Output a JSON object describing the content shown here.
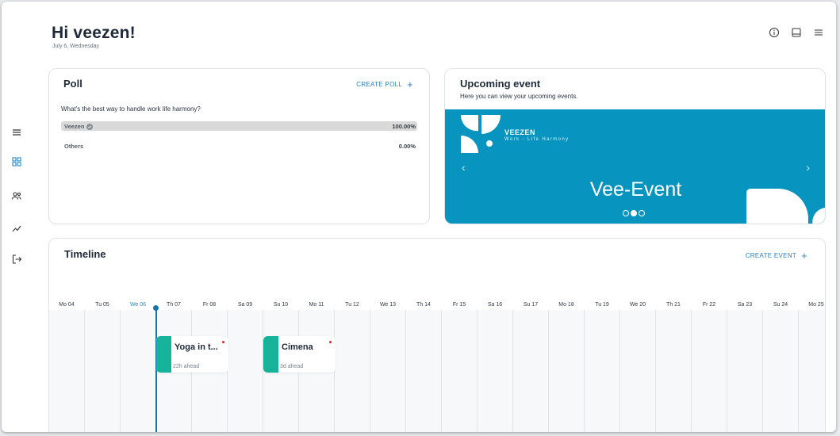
{
  "header": {
    "greeting": "Hi veezen!",
    "date": "July 6, Wednesday",
    "icons": [
      "info-icon",
      "inbox-icon",
      "menu-icon"
    ]
  },
  "sidebar": {
    "items": [
      {
        "icon": "menu-icon"
      },
      {
        "icon": "dashboard-icon",
        "active": true
      },
      {
        "icon": "users-icon"
      },
      {
        "icon": "trend-icon"
      },
      {
        "icon": "logout-icon"
      }
    ]
  },
  "colors": {
    "accent": "#2f7fc1",
    "banner": "#0794bf",
    "event": "#16b39a",
    "today": "#1775a9"
  },
  "poll": {
    "title": "Poll",
    "create_label": "CREATE POLL",
    "question": "What's the best way to handle work life harmony?",
    "options": [
      {
        "label": "Veezen",
        "percent": "100.00%",
        "fraction": 1.0,
        "voted": true
      },
      {
        "label": "Others",
        "percent": "0.00%",
        "fraction": 0.0,
        "voted": false
      }
    ]
  },
  "upcoming": {
    "title": "Upcoming event",
    "subtitle": "Here you can view your upcoming events.",
    "banner": {
      "brand": "VEEZEN",
      "tagline": "Work - Life Harmony",
      "title": "Vee-Event",
      "prev": "‹",
      "next": "›",
      "slides": 3,
      "active_slide": 2
    }
  },
  "timeline": {
    "title": "Timeline",
    "create_label": "CREATE EVENT",
    "days": [
      "Mo 04",
      "Tu 05",
      "We 06",
      "Th 07",
      "Fr 08",
      "Sa 09",
      "Su 10",
      "Mo 11",
      "Tu 12",
      "We 13",
      "Th 14",
      "Fr 15",
      "Sa 16",
      "Su 17",
      "Mo 18",
      "Tu 19",
      "We 20",
      "Th 21",
      "Fr 22",
      "Sa 23",
      "Su 24",
      "Mo 25"
    ],
    "today": "We 06",
    "events": [
      {
        "name": "Yoga in t...",
        "ahead": "22h ahead",
        "day": "Th 07"
      },
      {
        "name": "Cimena",
        "ahead": "3d ahead",
        "day": "Su 10"
      }
    ]
  }
}
